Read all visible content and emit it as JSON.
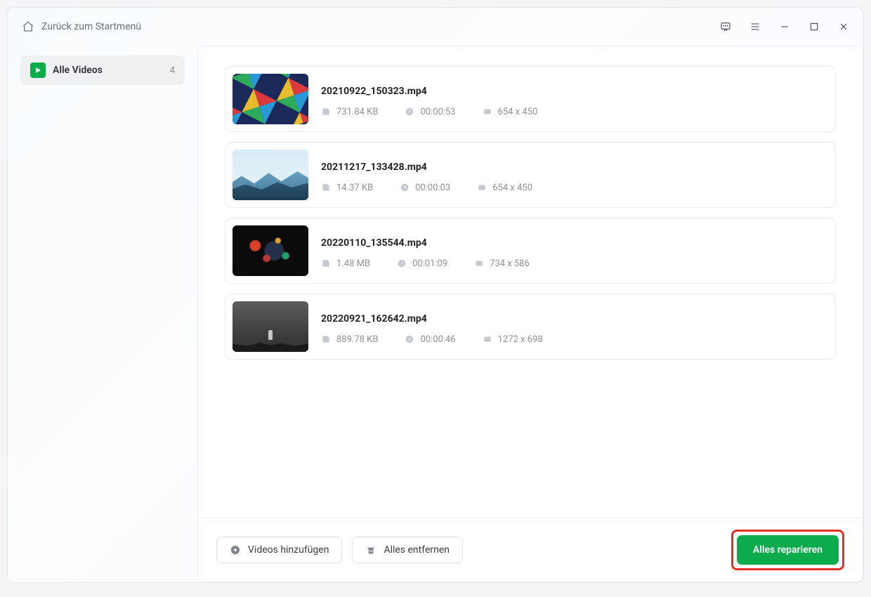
{
  "header": {
    "back_label": "Zurück zum Startmenü"
  },
  "sidebar": {
    "all_videos_label": "Alle Videos",
    "count": "4"
  },
  "videos": [
    {
      "name": "20210922_150323.mp4",
      "size": "731.84 KB",
      "duration": "00:00:53",
      "dim": "654 x 450"
    },
    {
      "name": "20211217_133428.mp4",
      "size": "14.37 KB",
      "duration": "00:00:03",
      "dim": "654 x 450"
    },
    {
      "name": "20220110_135544.mp4",
      "size": "1.48 MB",
      "duration": "00:01:09",
      "dim": "734 x 586"
    },
    {
      "name": "20220921_162642.mp4",
      "size": "889.78 KB",
      "duration": "00:00:46",
      "dim": "1272 x 698"
    }
  ],
  "footer": {
    "add_label": "Videos hinzufügen",
    "remove_all_label": "Alles entfernen",
    "repair_all_label": "Alles reparieren"
  }
}
